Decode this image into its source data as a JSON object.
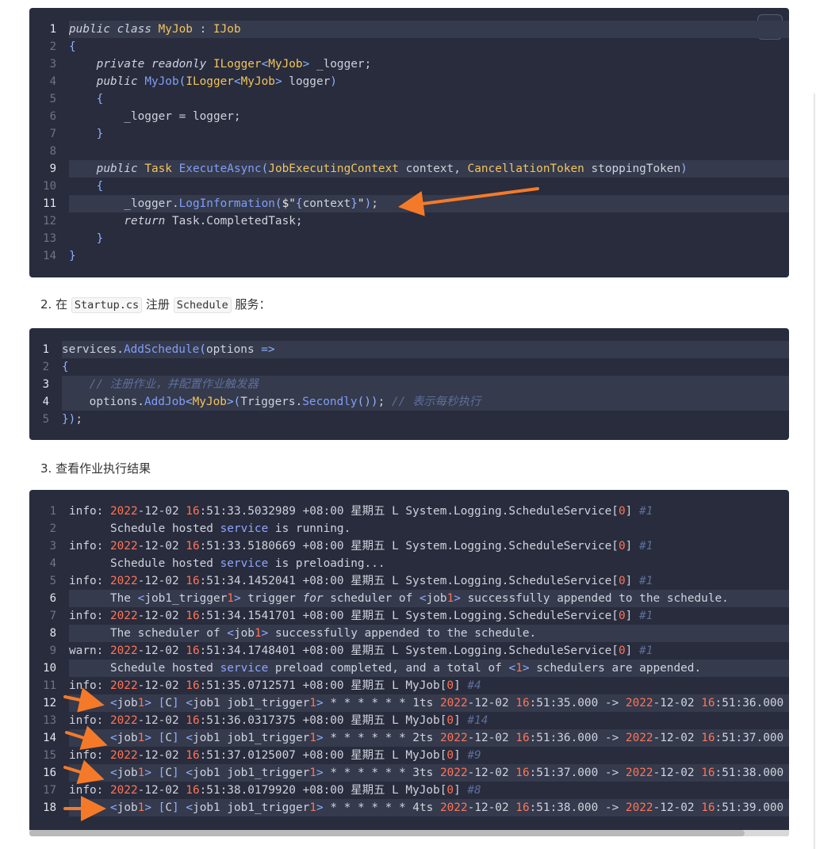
{
  "copy_button": {
    "icon": "copy-icon"
  },
  "step2": {
    "prefix": "2. 在 ",
    "file": "Startup.cs",
    "mid": " 注册 ",
    "name": "Schedule",
    "suffix": " 服务："
  },
  "step3": {
    "text": "3. 查看作业执行结果"
  },
  "block1": {
    "line_numbers": [
      "1",
      "2",
      "3",
      "4",
      "5",
      "6",
      "7",
      "8",
      "9",
      "10",
      "11",
      "12",
      "13",
      "14"
    ],
    "highlighted_lines": [
      1,
      9,
      11
    ]
  },
  "block2": {
    "line_numbers": [
      "1",
      "2",
      "3",
      "4",
      "5"
    ],
    "highlighted_lines": [
      1,
      3,
      4
    ]
  },
  "block3": {
    "line_numbers": [
      "1",
      "2",
      "3",
      "4",
      "5",
      "6",
      "7",
      "8",
      "9",
      "10",
      "11",
      "12",
      "13",
      "14",
      "15",
      "16",
      "17",
      "18"
    ],
    "highlighted_lines": [
      6,
      8,
      10,
      12,
      14,
      16,
      18
    ]
  },
  "colors": {
    "code_background": "#282c3c",
    "highlight_line": "#353a4c",
    "keyword_type": "#f2c45e",
    "function": "#7f9ef7",
    "number": "#ff7458",
    "comment": "#5d6f9b",
    "annotation_arrow": "#f47a2a"
  },
  "annotations": {
    "arrow_icon": "orange-arrow-icon",
    "count": 5
  }
}
